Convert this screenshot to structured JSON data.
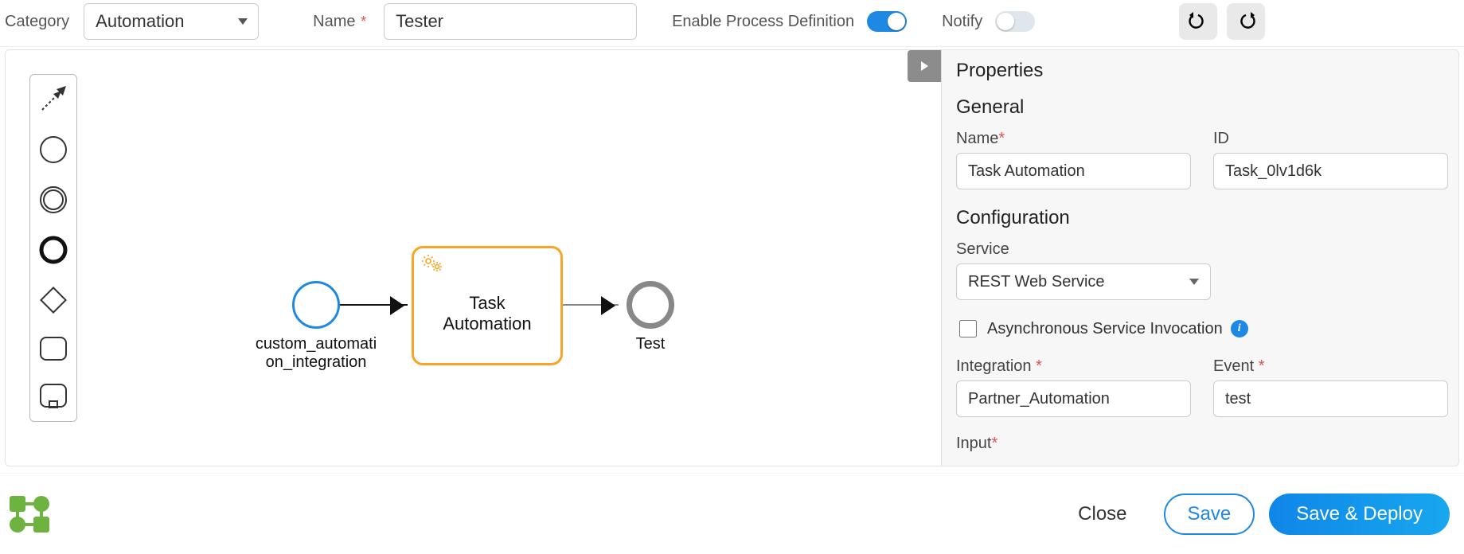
{
  "top": {
    "category_label": "Category",
    "category_value": "Automation",
    "name_label": "Name",
    "name_value": "Tester",
    "enable_process_label": "Enable Process Definition",
    "enable_process_on": true,
    "notify_label": "Notify",
    "notify_on": false
  },
  "palette": {
    "tools": [
      "arrow-tool",
      "start-event",
      "intermediate-event",
      "end-event",
      "gateway",
      "task",
      "subprocess"
    ]
  },
  "diagram": {
    "start_label": "custom_automati\non_integration",
    "task_label": "Task\nAutomation",
    "end_label": "Test"
  },
  "panel": {
    "title": "Properties",
    "section_general": "General",
    "name_label": "Name",
    "name_value": "Task Automation",
    "id_label": "ID",
    "id_value": "Task_0lv1d6k",
    "section_config": "Configuration",
    "service_label": "Service",
    "service_value": "REST Web Service",
    "async_label": "Asynchronous Service Invocation",
    "async_checked": false,
    "integration_label": "Integration",
    "integration_value": "Partner_Automation",
    "event_label": "Event",
    "event_value": "test",
    "input_label": "Input"
  },
  "footer": {
    "close": "Close",
    "save": "Save",
    "save_deploy": "Save & Deploy"
  }
}
